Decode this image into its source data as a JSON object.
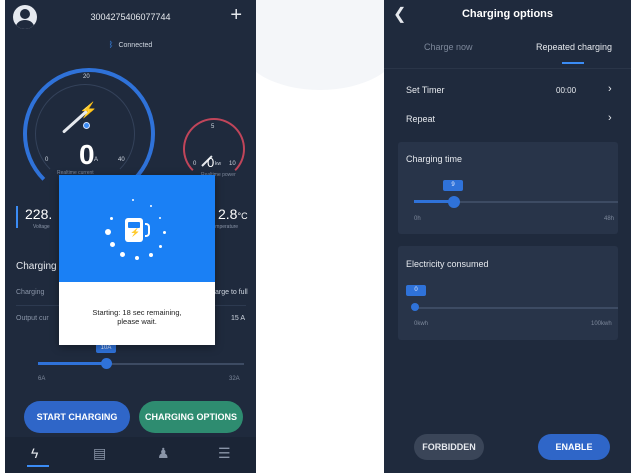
{
  "left": {
    "device_id": "3004275406077744",
    "connection_status": "Connected",
    "icons": {
      "avatar": "avatar-icon",
      "add": "plus-icon",
      "bluetooth": "bluetooth-icon",
      "bolt": "bolt-icon"
    },
    "current_gauge": {
      "value": "0",
      "unit": "A",
      "min_label": "0",
      "mid_label": "20",
      "max_label": "40",
      "caption": "Realtime current"
    },
    "power_gauge": {
      "value": "0",
      "unit": "kw",
      "min_label": "0",
      "top_label": "5",
      "max_label": "10",
      "caption": "Realtime power"
    },
    "voltage": {
      "value": "228.",
      "caption": "Voltage"
    },
    "temperature": {
      "value": "2.8",
      "unit": "°C",
      "caption": "Temperature"
    },
    "section_title": "Charging",
    "row1": {
      "label": "Charging",
      "right": "arge to full"
    },
    "row2": {
      "label": "Output cur",
      "right": "15 A"
    },
    "current_slider": {
      "value_label": "10A",
      "min_label": "6A",
      "max_label": "32A",
      "fraction": 0.31
    },
    "buttons": {
      "start": "START CHARGING",
      "options": "CHARGING OPTIONS"
    },
    "tabbar": [
      "bolt-tab-icon",
      "records-tab-icon",
      "bell-tab-icon",
      "menu-tab-icon"
    ],
    "modal": {
      "message_line1": "Starting: 18 sec remaining,",
      "message_line2": "please wait."
    }
  },
  "right": {
    "title": "Charging options",
    "tabs": [
      {
        "label": "Charge now",
        "active": false
      },
      {
        "label": "Repeated charging",
        "active": true
      }
    ],
    "set_timer": {
      "label": "Set Timer",
      "value": "00:00"
    },
    "repeat": {
      "label": "Repeat"
    },
    "charging_time": {
      "title": "Charging time",
      "value_label": "9",
      "min_label": "0h",
      "max_label": "48h",
      "fraction": 0.19
    },
    "electricity": {
      "title": "Electricity consumed",
      "value_label": "0",
      "min_label": "0kwh",
      "max_label": "100kwh",
      "fraction": 0.0
    },
    "buttons": {
      "forbidden": "FORBIDDEN",
      "enable": "ENABLE"
    }
  },
  "colors": {
    "background": "#1f2a3d",
    "accent_blue": "#2f72d9",
    "modal_blue": "#1a80f5",
    "green": "#2e8c70",
    "bolt_green": "#2ec27e",
    "power_ring": "#c0455a"
  }
}
